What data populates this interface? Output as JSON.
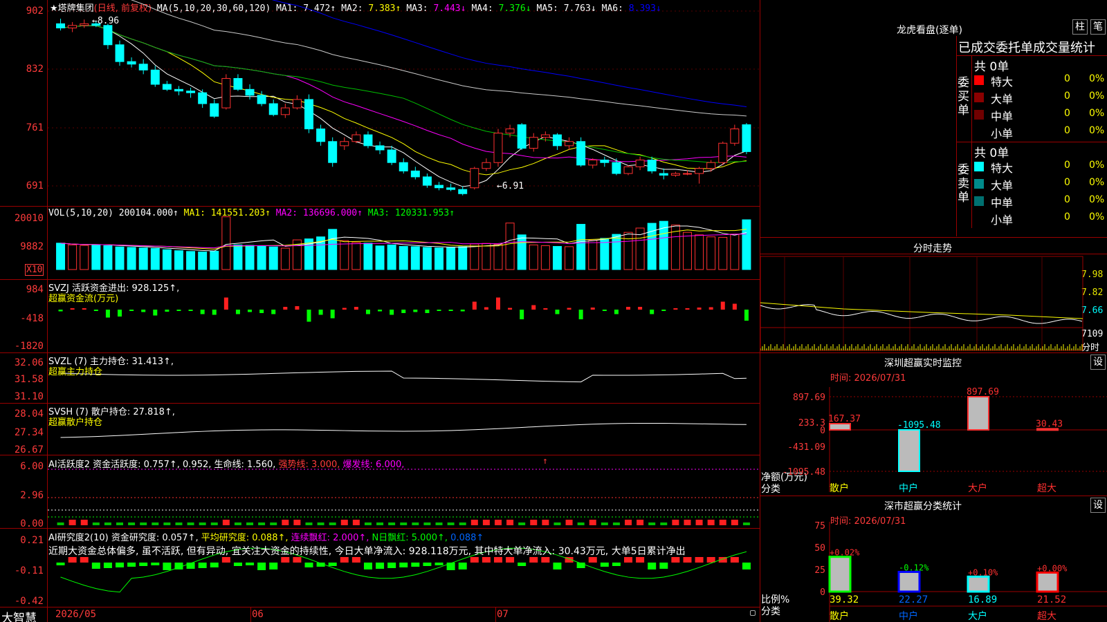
{
  "main": {
    "title": "★塔牌集团",
    "subtitle": "(日线, 前复权)",
    "ma_label": "MA(5,10,20,30,60,120)",
    "ma": [
      {
        "k": "MA1:",
        "v": "7.472↑",
        "c": "#ffffff"
      },
      {
        "k": "MA2:",
        "v": "7.383↑",
        "c": "#ffff00"
      },
      {
        "k": "MA3:",
        "v": "7.443↓",
        "c": "#ff00ff"
      },
      {
        "k": "MA4:",
        "v": "7.376↓",
        "c": "#00ff00"
      },
      {
        "k": "MA5:",
        "v": "7.763↓",
        "c": "#ffffff"
      },
      {
        "k": "MA6:",
        "v": "8.393↓",
        "c": "#0000ff"
      }
    ],
    "yticks": [
      "902",
      "832",
      "761",
      "691"
    ],
    "hi_label": "8.96",
    "lo_label": "6.91"
  },
  "vol": {
    "label": "VOL(5,10,20)",
    "value": "200104.000↑",
    "ma1": "MA1: 141551.203↑",
    "ma2": "MA2: 136696.000↑",
    "ma3": "MA3: 120331.953↑",
    "yticks": [
      "20010",
      "9882"
    ],
    "unit": "X10"
  },
  "svzj": {
    "label": "SVZJ  活跃资金进出: 928.125↑,",
    "sub": "超赢资金流(万元)",
    "yticks": [
      "984",
      "-418",
      "-1820"
    ]
  },
  "svzl": {
    "label": "SVZL (7) 主力持仓: 31.413↑,",
    "sub": "超赢主力持仓",
    "yticks": [
      "32.06",
      "31.58",
      "31.10"
    ]
  },
  "svsh": {
    "label": "SVSH (7) 散户持仓: 27.818↑,",
    "sub": "超赢散户持仓",
    "yticks": [
      "28.04",
      "27.34",
      "26.67"
    ]
  },
  "ai1": {
    "label": "AI活跃度2",
    "text1": "资金活跃度: 0.757↑, 0.952, 生命线: 1.560,",
    "text2": "强势线: 3.000,",
    "text3": "爆发线: 6.000,",
    "arrow": "↑",
    "yticks": [
      "6.00",
      "2.96",
      "0.00"
    ]
  },
  "ai2": {
    "label": "AI研究度2(10)",
    "t1": "资金研究度: 0.057↑,",
    "t2": "平均研究度: 0.088↑,",
    "t3": "连续飘红: 2.000↑,",
    "t4": "N日飘红: 5.000↑,",
    "t5": "0.088↑",
    "note": "近期大资金总体偏多, 虽不活跃, 但有异动, 宜关注大资金的持续性, 今日大单净流入: 928.118万元, 其中特大单净流入: 30.43万元, 大单5日累计净出",
    "yticks": [
      "0.21",
      "-0.11",
      "-0.42"
    ]
  },
  "footer": {
    "brand": "大智慧",
    "dates": [
      "2026/05",
      "06",
      "07"
    ]
  },
  "right": {
    "dragon_title": "龙虎看盘(逐单)",
    "btn_zhu": "柱",
    "btn_bi": "笔",
    "table_title": "已成交委托单成交量统计",
    "buy_label": "委买单",
    "sell_label": "委卖单",
    "buy_total": "共 0单",
    "sell_total": "共 0单",
    "buy_rows": [
      {
        "name": "特大",
        "n": "0",
        "p": "0%",
        "c": "#ff0000"
      },
      {
        "name": "大单",
        "n": "0",
        "p": "0%",
        "c": "#8b0000"
      },
      {
        "name": "中单",
        "n": "0",
        "p": "0%",
        "c": "#700000"
      },
      {
        "name": "小单",
        "n": "0",
        "p": "0%",
        "c": "#000000"
      }
    ],
    "sell_rows": [
      {
        "name": "特大",
        "n": "0",
        "p": "0%",
        "c": "#00ffff"
      },
      {
        "name": "大单",
        "n": "0",
        "p": "0%",
        "c": "#008b8b"
      },
      {
        "name": "中单",
        "n": "0",
        "p": "0%",
        "c": "#007070"
      },
      {
        "name": "小单",
        "n": "0",
        "p": "0%",
        "c": "#000000"
      }
    ],
    "fenshi_title": "分时走势",
    "fenshi_y": [
      "7.98",
      "7.82",
      "7.66"
    ],
    "fenshi_vol": "7109",
    "fenshi_unit": "分时",
    "monitor_title": "深圳超赢实时监控",
    "monitor_time": "时间: 2026/07/31",
    "set_label": "设",
    "monitor_y": [
      "897.69",
      "233.3",
      "0",
      "-431.09",
      "-1095.48"
    ],
    "monitor_unit": "净额(万元)",
    "monitor_cat_label": "分类",
    "monitor_bars": [
      {
        "name": "散户",
        "value": "167.37",
        "v": 167.37
      },
      {
        "name": "中户",
        "value": "-1095.48",
        "v": -1095.48
      },
      {
        "name": "大户",
        "value": "897.69",
        "v": 897.69
      },
      {
        "name": "超大",
        "value": "30.43",
        "v": 30.43
      }
    ],
    "stat_title": "深市超赢分类统计",
    "stat_time": "时间: 2026/07/31",
    "stat_y": [
      "75",
      "50",
      "25",
      "0"
    ],
    "stat_unit": "比例%",
    "stat_cat_label": "分类",
    "stat_bars": [
      {
        "name": "散户",
        "pct": "39.32",
        "chg": "+0.02%",
        "v": 39.32,
        "c": "#00ff00"
      },
      {
        "name": "中户",
        "pct": "22.27",
        "chg": "-0.12%",
        "v": 22.27,
        "c": "#0000ff"
      },
      {
        "name": "大户",
        "pct": "16.89",
        "chg": "+0.10%",
        "v": 16.89,
        "c": "#00ffff"
      },
      {
        "name": "超大",
        "pct": "21.52",
        "chg": "+0.00%",
        "v": 21.52,
        "c": "#ff0000"
      }
    ]
  },
  "chart_data": [
    {
      "type": "candlestick",
      "name": "daily-kline",
      "ylim": [
        6.8,
        9.1
      ],
      "ohlc": [
        [
          8.9,
          8.96,
          8.82,
          8.85
        ],
        [
          8.85,
          8.92,
          8.8,
          8.88
        ],
        [
          8.88,
          8.95,
          8.85,
          8.9
        ],
        [
          8.9,
          8.93,
          8.86,
          8.88
        ],
        [
          8.88,
          8.9,
          8.6,
          8.65
        ],
        [
          8.65,
          8.7,
          8.4,
          8.45
        ],
        [
          8.45,
          8.5,
          8.38,
          8.42
        ],
        [
          8.42,
          8.48,
          8.3,
          8.35
        ],
        [
          8.35,
          8.4,
          8.15,
          8.18
        ],
        [
          8.18,
          8.22,
          8.1,
          8.12
        ],
        [
          8.12,
          8.16,
          8.05,
          8.1
        ],
        [
          8.1,
          8.14,
          8.02,
          8.08
        ],
        [
          8.08,
          8.12,
          7.9,
          7.95
        ],
        [
          7.95,
          8.0,
          7.78,
          7.8
        ],
        [
          7.9,
          8.3,
          7.88,
          8.25
        ],
        [
          8.25,
          8.3,
          8.1,
          8.12
        ],
        [
          8.12,
          8.18,
          8.0,
          8.05
        ],
        [
          8.05,
          8.1,
          7.92,
          7.95
        ],
        [
          7.95,
          8.0,
          7.8,
          7.82
        ],
        [
          7.82,
          7.95,
          7.78,
          7.9
        ],
        [
          7.9,
          8.05,
          7.88,
          8.0
        ],
        [
          8.0,
          8.06,
          7.6,
          7.65
        ],
        [
          7.65,
          7.7,
          7.45,
          7.5
        ],
        [
          7.5,
          7.55,
          7.2,
          7.25
        ],
        [
          7.45,
          7.55,
          7.4,
          7.5
        ],
        [
          7.5,
          7.62,
          7.48,
          7.58
        ],
        [
          7.58,
          7.62,
          7.42,
          7.45
        ],
        [
          7.45,
          7.5,
          7.35,
          7.4
        ],
        [
          7.4,
          7.45,
          7.22,
          7.25
        ],
        [
          7.25,
          7.3,
          7.12,
          7.15
        ],
        [
          7.15,
          7.2,
          7.05,
          7.08
        ],
        [
          7.08,
          7.12,
          6.95,
          6.98
        ],
        [
          6.98,
          7.02,
          6.92,
          6.95
        ],
        [
          6.95,
          7.0,
          6.91,
          6.93
        ],
        [
          6.93,
          6.97,
          6.86,
          6.88
        ],
        [
          6.95,
          7.2,
          6.93,
          7.18
        ],
        [
          7.18,
          7.3,
          7.15,
          7.25
        ],
        [
          7.25,
          7.65,
          7.2,
          7.6
        ],
        [
          7.6,
          7.7,
          7.55,
          7.65
        ],
        [
          7.7,
          7.72,
          7.4,
          7.42
        ],
        [
          7.42,
          7.6,
          7.38,
          7.55
        ],
        [
          7.55,
          7.62,
          7.5,
          7.58
        ],
        [
          7.58,
          7.6,
          7.4,
          7.45
        ],
        [
          7.45,
          7.55,
          7.4,
          7.5
        ],
        [
          7.5,
          7.55,
          7.2,
          7.22
        ],
        [
          7.22,
          7.3,
          7.18,
          7.28
        ],
        [
          7.28,
          7.32,
          7.2,
          7.25
        ],
        [
          7.25,
          7.3,
          7.1,
          7.12
        ],
        [
          7.12,
          7.22,
          7.1,
          7.2
        ],
        [
          7.2,
          7.32,
          7.16,
          7.28
        ],
        [
          7.28,
          7.32,
          7.12,
          7.15
        ],
        [
          7.12,
          7.18,
          7.05,
          7.1
        ],
        [
          7.1,
          7.14,
          7.08,
          7.12
        ],
        [
          7.12,
          7.16,
          7.1,
          7.12
        ],
        [
          7.12,
          7.2,
          7.0,
          7.18
        ],
        [
          7.18,
          7.28,
          7.14,
          7.25
        ],
        [
          7.25,
          7.5,
          7.22,
          7.48
        ],
        [
          7.48,
          7.7,
          7.45,
          7.65
        ],
        [
          7.7,
          7.72,
          7.35,
          7.38
        ]
      ]
    },
    {
      "type": "bar",
      "name": "volume",
      "ylim": [
        0,
        22000
      ],
      "values": [
        10500,
        9800,
        9600,
        9900,
        9500,
        9000,
        8800,
        8600,
        8400,
        7900,
        7500,
        7200,
        7000,
        7300,
        21000,
        9800,
        9600,
        9400,
        9000,
        8500,
        11800,
        12200,
        13000,
        16000,
        11500,
        10800,
        10500,
        9400,
        9800,
        9200,
        9100,
        8800,
        8600,
        8900,
        9100,
        10200,
        10400,
        10000,
        18500,
        13800,
        9800,
        9500,
        9200,
        9100,
        18000,
        11600,
        12400,
        14000,
        14800,
        16500,
        18400,
        19200,
        17700,
        14800,
        13800,
        13000,
        12800,
        14100,
        19800
      ]
    }
  ]
}
